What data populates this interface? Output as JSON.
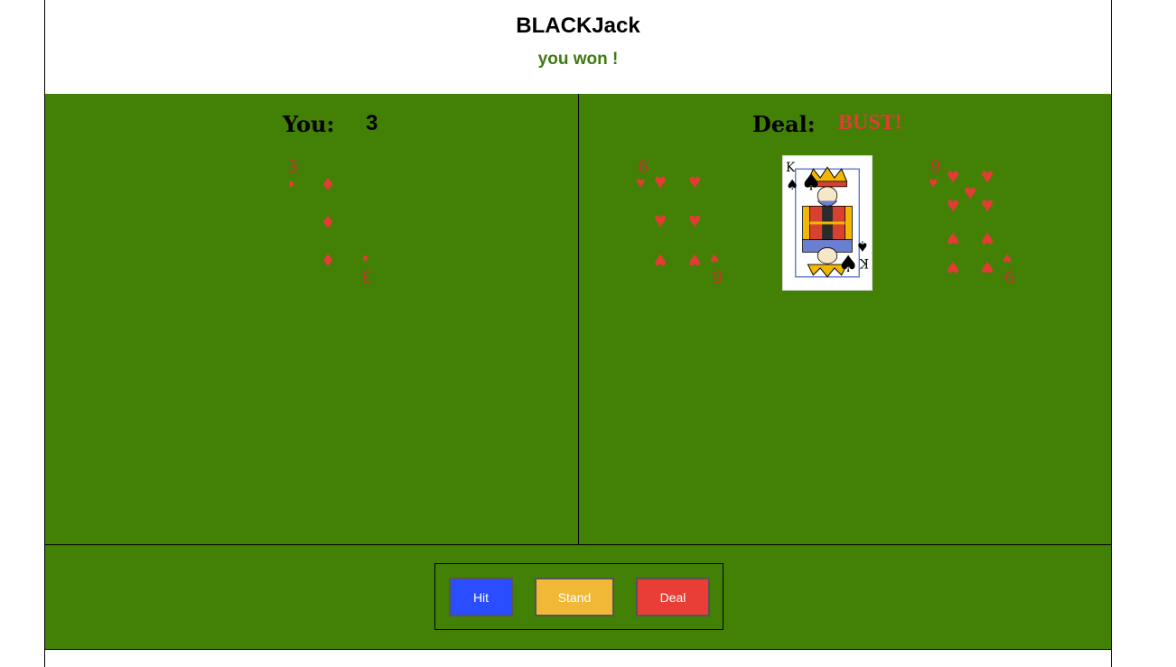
{
  "header": {
    "title": "BLACKJack",
    "result": "you won !"
  },
  "player": {
    "label": "You:",
    "score": "3",
    "cards": [
      {
        "rank": "3",
        "suit": "diamonds"
      }
    ]
  },
  "dealer": {
    "label": "Deal:",
    "score": "BUST!",
    "cards": [
      {
        "rank": "6",
        "suit": "hearts"
      },
      {
        "rank": "K",
        "suit": "spades"
      },
      {
        "rank": "9",
        "suit": "hearts"
      }
    ]
  },
  "controls": {
    "hit": "Hit",
    "stand": "Stand",
    "deal": "Deal"
  },
  "colors": {
    "felt": "#428006",
    "red_suit": "#e43b34",
    "hit": "#2a4dff",
    "stand": "#f1b838",
    "deal": "#e83e35",
    "won": "#3f7a12"
  }
}
